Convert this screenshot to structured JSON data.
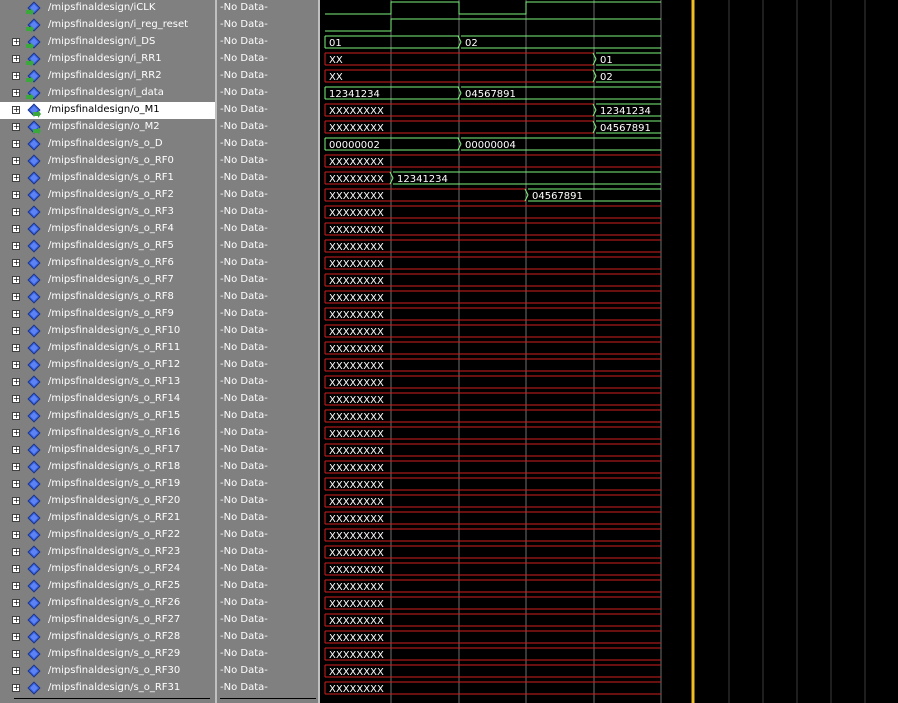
{
  "colors": {
    "wave_green": "#7cf27c",
    "wave_red": "#d01e1e",
    "cursor": "#f0c020",
    "grid": "#3c3c3c",
    "boundary": "#6e6e6e",
    "icon_blue": "#2f5bd8",
    "icon_green": "#3aa83a"
  },
  "signals": [
    {
      "name": "/mipsfinaldesign/iCLK",
      "value": "-No Data-",
      "expandable": false,
      "selected": false,
      "icon": "input-port-icon"
    },
    {
      "name": "/mipsfinaldesign/i_reg_reset",
      "value": "-No Data-",
      "expandable": false,
      "selected": false,
      "icon": "input-port-icon"
    },
    {
      "name": "/mipsfinaldesign/i_DS",
      "value": "-No Data-",
      "expandable": true,
      "selected": false,
      "icon": "input-port-icon"
    },
    {
      "name": "/mipsfinaldesign/i_RR1",
      "value": "-No Data-",
      "expandable": true,
      "selected": false,
      "icon": "input-port-icon"
    },
    {
      "name": "/mipsfinaldesign/i_RR2",
      "value": "-No Data-",
      "expandable": true,
      "selected": false,
      "icon": "input-port-icon"
    },
    {
      "name": "/mipsfinaldesign/i_data",
      "value": "-No Data-",
      "expandable": true,
      "selected": false,
      "icon": "input-port-icon"
    },
    {
      "name": "/mipsfinaldesign/o_M1",
      "value": "-No Data-",
      "expandable": true,
      "selected": true,
      "icon": "output-port-icon"
    },
    {
      "name": "/mipsfinaldesign/o_M2",
      "value": "-No Data-",
      "expandable": true,
      "selected": false,
      "icon": "output-port-icon"
    },
    {
      "name": "/mipsfinaldesign/s_o_D",
      "value": "-No Data-",
      "expandable": true,
      "selected": false,
      "icon": "internal-signal-icon"
    },
    {
      "name": "/mipsfinaldesign/s_o_RF0",
      "value": "-No Data-",
      "expandable": true,
      "selected": false,
      "icon": "internal-signal-icon"
    },
    {
      "name": "/mipsfinaldesign/s_o_RF1",
      "value": "-No Data-",
      "expandable": true,
      "selected": false,
      "icon": "internal-signal-icon"
    },
    {
      "name": "/mipsfinaldesign/s_o_RF2",
      "value": "-No Data-",
      "expandable": true,
      "selected": false,
      "icon": "internal-signal-icon"
    },
    {
      "name": "/mipsfinaldesign/s_o_RF3",
      "value": "-No Data-",
      "expandable": true,
      "selected": false,
      "icon": "internal-signal-icon"
    },
    {
      "name": "/mipsfinaldesign/s_o_RF4",
      "value": "-No Data-",
      "expandable": true,
      "selected": false,
      "icon": "internal-signal-icon"
    },
    {
      "name": "/mipsfinaldesign/s_o_RF5",
      "value": "-No Data-",
      "expandable": true,
      "selected": false,
      "icon": "internal-signal-icon"
    },
    {
      "name": "/mipsfinaldesign/s_o_RF6",
      "value": "-No Data-",
      "expandable": true,
      "selected": false,
      "icon": "internal-signal-icon"
    },
    {
      "name": "/mipsfinaldesign/s_o_RF7",
      "value": "-No Data-",
      "expandable": true,
      "selected": false,
      "icon": "internal-signal-icon"
    },
    {
      "name": "/mipsfinaldesign/s_o_RF8",
      "value": "-No Data-",
      "expandable": true,
      "selected": false,
      "icon": "internal-signal-icon"
    },
    {
      "name": "/mipsfinaldesign/s_o_RF9",
      "value": "-No Data-",
      "expandable": true,
      "selected": false,
      "icon": "internal-signal-icon"
    },
    {
      "name": "/mipsfinaldesign/s_o_RF10",
      "value": "-No Data-",
      "expandable": true,
      "selected": false,
      "icon": "internal-signal-icon"
    },
    {
      "name": "/mipsfinaldesign/s_o_RF11",
      "value": "-No Data-",
      "expandable": true,
      "selected": false,
      "icon": "internal-signal-icon"
    },
    {
      "name": "/mipsfinaldesign/s_o_RF12",
      "value": "-No Data-",
      "expandable": true,
      "selected": false,
      "icon": "internal-signal-icon"
    },
    {
      "name": "/mipsfinaldesign/s_o_RF13",
      "value": "-No Data-",
      "expandable": true,
      "selected": false,
      "icon": "internal-signal-icon"
    },
    {
      "name": "/mipsfinaldesign/s_o_RF14",
      "value": "-No Data-",
      "expandable": true,
      "selected": false,
      "icon": "internal-signal-icon"
    },
    {
      "name": "/mipsfinaldesign/s_o_RF15",
      "value": "-No Data-",
      "expandable": true,
      "selected": false,
      "icon": "internal-signal-icon"
    },
    {
      "name": "/mipsfinaldesign/s_o_RF16",
      "value": "-No Data-",
      "expandable": true,
      "selected": false,
      "icon": "internal-signal-icon"
    },
    {
      "name": "/mipsfinaldesign/s_o_RF17",
      "value": "-No Data-",
      "expandable": true,
      "selected": false,
      "icon": "internal-signal-icon"
    },
    {
      "name": "/mipsfinaldesign/s_o_RF18",
      "value": "-No Data-",
      "expandable": true,
      "selected": false,
      "icon": "internal-signal-icon"
    },
    {
      "name": "/mipsfinaldesign/s_o_RF19",
      "value": "-No Data-",
      "expandable": true,
      "selected": false,
      "icon": "internal-signal-icon"
    },
    {
      "name": "/mipsfinaldesign/s_o_RF20",
      "value": "-No Data-",
      "expandable": true,
      "selected": false,
      "icon": "internal-signal-icon"
    },
    {
      "name": "/mipsfinaldesign/s_o_RF21",
      "value": "-No Data-",
      "expandable": true,
      "selected": false,
      "icon": "internal-signal-icon"
    },
    {
      "name": "/mipsfinaldesign/s_o_RF22",
      "value": "-No Data-",
      "expandable": true,
      "selected": false,
      "icon": "internal-signal-icon"
    },
    {
      "name": "/mipsfinaldesign/s_o_RF23",
      "value": "-No Data-",
      "expandable": true,
      "selected": false,
      "icon": "internal-signal-icon"
    },
    {
      "name": "/mipsfinaldesign/s_o_RF24",
      "value": "-No Data-",
      "expandable": true,
      "selected": false,
      "icon": "internal-signal-icon"
    },
    {
      "name": "/mipsfinaldesign/s_o_RF25",
      "value": "-No Data-",
      "expandable": true,
      "selected": false,
      "icon": "internal-signal-icon"
    },
    {
      "name": "/mipsfinaldesign/s_o_RF26",
      "value": "-No Data-",
      "expandable": true,
      "selected": false,
      "icon": "internal-signal-icon"
    },
    {
      "name": "/mipsfinaldesign/s_o_RF27",
      "value": "-No Data-",
      "expandable": true,
      "selected": false,
      "icon": "internal-signal-icon"
    },
    {
      "name": "/mipsfinaldesign/s_o_RF28",
      "value": "-No Data-",
      "expandable": true,
      "selected": false,
      "icon": "internal-signal-icon"
    },
    {
      "name": "/mipsfinaldesign/s_o_RF29",
      "value": "-No Data-",
      "expandable": true,
      "selected": false,
      "icon": "internal-signal-icon"
    },
    {
      "name": "/mipsfinaldesign/s_o_RF30",
      "value": "-No Data-",
      "expandable": true,
      "selected": false,
      "icon": "internal-signal-icon"
    },
    {
      "name": "/mipsfinaldesign/s_o_RF31",
      "value": "-No Data-",
      "expandable": true,
      "selected": false,
      "icon": "internal-signal-icon"
    }
  ],
  "waves": [
    {
      "kind": "clock",
      "levels": [
        0,
        1,
        0,
        1,
        1
      ]
    },
    {
      "kind": "bit",
      "levels": [
        0,
        1,
        1,
        1,
        1
      ]
    },
    {
      "kind": "bus",
      "segments": [
        {
          "from": 0,
          "to": 2,
          "label": "01",
          "color": "green"
        },
        {
          "from": 2,
          "to": 5,
          "label": "02",
          "color": "green"
        }
      ]
    },
    {
      "kind": "bus",
      "segments": [
        {
          "from": 0,
          "to": 4,
          "label": "XX",
          "color": "red"
        },
        {
          "from": 4,
          "to": 5,
          "label": "01",
          "color": "green"
        }
      ]
    },
    {
      "kind": "bus",
      "segments": [
        {
          "from": 0,
          "to": 4,
          "label": "XX",
          "color": "red"
        },
        {
          "from": 4,
          "to": 5,
          "label": "02",
          "color": "green"
        }
      ]
    },
    {
      "kind": "bus",
      "segments": [
        {
          "from": 0,
          "to": 2,
          "label": "12341234",
          "color": "green"
        },
        {
          "from": 2,
          "to": 5,
          "label": "04567891",
          "color": "green"
        }
      ]
    },
    {
      "kind": "bus",
      "segments": [
        {
          "from": 0,
          "to": 4,
          "label": "XXXXXXXX",
          "color": "red"
        },
        {
          "from": 4,
          "to": 5,
          "label": "12341234",
          "color": "green"
        }
      ]
    },
    {
      "kind": "bus",
      "segments": [
        {
          "from": 0,
          "to": 4,
          "label": "XXXXXXXX",
          "color": "red"
        },
        {
          "from": 4,
          "to": 5,
          "label": "04567891",
          "color": "green"
        }
      ]
    },
    {
      "kind": "bus",
      "segments": [
        {
          "from": 0,
          "to": 2,
          "label": "00000002",
          "color": "green"
        },
        {
          "from": 2,
          "to": 5,
          "label": "00000004",
          "color": "green"
        }
      ]
    },
    {
      "kind": "bus",
      "segments": [
        {
          "from": 0,
          "to": 5,
          "label": "XXXXXXXX",
          "color": "red"
        }
      ]
    },
    {
      "kind": "bus",
      "segments": [
        {
          "from": 0,
          "to": 1,
          "label": "XXXXXXXX",
          "color": "red"
        },
        {
          "from": 1,
          "to": 5,
          "label": "12341234",
          "color": "green"
        }
      ]
    },
    {
      "kind": "bus",
      "segments": [
        {
          "from": 0,
          "to": 3,
          "label": "XXXXXXXX",
          "color": "red"
        },
        {
          "from": 3,
          "to": 5,
          "label": "04567891",
          "color": "green"
        }
      ]
    },
    {
      "kind": "bus",
      "segments": [
        {
          "from": 0,
          "to": 5,
          "label": "XXXXXXXX",
          "color": "red"
        }
      ]
    },
    {
      "kind": "bus",
      "segments": [
        {
          "from": 0,
          "to": 5,
          "label": "XXXXXXXX",
          "color": "red"
        }
      ]
    },
    {
      "kind": "bus",
      "segments": [
        {
          "from": 0,
          "to": 5,
          "label": "XXXXXXXX",
          "color": "red"
        }
      ]
    },
    {
      "kind": "bus",
      "segments": [
        {
          "from": 0,
          "to": 5,
          "label": "XXXXXXXX",
          "color": "red"
        }
      ]
    },
    {
      "kind": "bus",
      "segments": [
        {
          "from": 0,
          "to": 5,
          "label": "XXXXXXXX",
          "color": "red"
        }
      ]
    },
    {
      "kind": "bus",
      "segments": [
        {
          "from": 0,
          "to": 5,
          "label": "XXXXXXXX",
          "color": "red"
        }
      ]
    },
    {
      "kind": "bus",
      "segments": [
        {
          "from": 0,
          "to": 5,
          "label": "XXXXXXXX",
          "color": "red"
        }
      ]
    },
    {
      "kind": "bus",
      "segments": [
        {
          "from": 0,
          "to": 5,
          "label": "XXXXXXXX",
          "color": "red"
        }
      ]
    },
    {
      "kind": "bus",
      "segments": [
        {
          "from": 0,
          "to": 5,
          "label": "XXXXXXXX",
          "color": "red"
        }
      ]
    },
    {
      "kind": "bus",
      "segments": [
        {
          "from": 0,
          "to": 5,
          "label": "XXXXXXXX",
          "color": "red"
        }
      ]
    },
    {
      "kind": "bus",
      "segments": [
        {
          "from": 0,
          "to": 5,
          "label": "XXXXXXXX",
          "color": "red"
        }
      ]
    },
    {
      "kind": "bus",
      "segments": [
        {
          "from": 0,
          "to": 5,
          "label": "XXXXXXXX",
          "color": "red"
        }
      ]
    },
    {
      "kind": "bus",
      "segments": [
        {
          "from": 0,
          "to": 5,
          "label": "XXXXXXXX",
          "color": "red"
        }
      ]
    },
    {
      "kind": "bus",
      "segments": [
        {
          "from": 0,
          "to": 5,
          "label": "XXXXXXXX",
          "color": "red"
        }
      ]
    },
    {
      "kind": "bus",
      "segments": [
        {
          "from": 0,
          "to": 5,
          "label": "XXXXXXXX",
          "color": "red"
        }
      ]
    },
    {
      "kind": "bus",
      "segments": [
        {
          "from": 0,
          "to": 5,
          "label": "XXXXXXXX",
          "color": "red"
        }
      ]
    },
    {
      "kind": "bus",
      "segments": [
        {
          "from": 0,
          "to": 5,
          "label": "XXXXXXXX",
          "color": "red"
        }
      ]
    },
    {
      "kind": "bus",
      "segments": [
        {
          "from": 0,
          "to": 5,
          "label": "XXXXXXXX",
          "color": "red"
        }
      ]
    },
    {
      "kind": "bus",
      "segments": [
        {
          "from": 0,
          "to": 5,
          "label": "XXXXXXXX",
          "color": "red"
        }
      ]
    },
    {
      "kind": "bus",
      "segments": [
        {
          "from": 0,
          "to": 5,
          "label": "XXXXXXXX",
          "color": "red"
        }
      ]
    },
    {
      "kind": "bus",
      "segments": [
        {
          "from": 0,
          "to": 5,
          "label": "XXXXXXXX",
          "color": "red"
        }
      ]
    },
    {
      "kind": "bus",
      "segments": [
        {
          "from": 0,
          "to": 5,
          "label": "XXXXXXXX",
          "color": "red"
        }
      ]
    },
    {
      "kind": "bus",
      "segments": [
        {
          "from": 0,
          "to": 5,
          "label": "XXXXXXXX",
          "color": "red"
        }
      ]
    },
    {
      "kind": "bus",
      "segments": [
        {
          "from": 0,
          "to": 5,
          "label": "XXXXXXXX",
          "color": "red"
        }
      ]
    },
    {
      "kind": "bus",
      "segments": [
        {
          "from": 0,
          "to": 5,
          "label": "XXXXXXXX",
          "color": "red"
        }
      ]
    },
    {
      "kind": "bus",
      "segments": [
        {
          "from": 0,
          "to": 5,
          "label": "XXXXXXXX",
          "color": "red"
        }
      ]
    },
    {
      "kind": "bus",
      "segments": [
        {
          "from": 0,
          "to": 5,
          "label": "XXXXXXXX",
          "color": "red"
        }
      ]
    },
    {
      "kind": "bus",
      "segments": [
        {
          "from": 0,
          "to": 5,
          "label": "XXXXXXXX",
          "color": "red"
        }
      ]
    },
    {
      "kind": "bus",
      "segments": [
        {
          "from": 0,
          "to": 5,
          "label": "XXXXXXXX",
          "color": "red"
        }
      ]
    }
  ]
}
